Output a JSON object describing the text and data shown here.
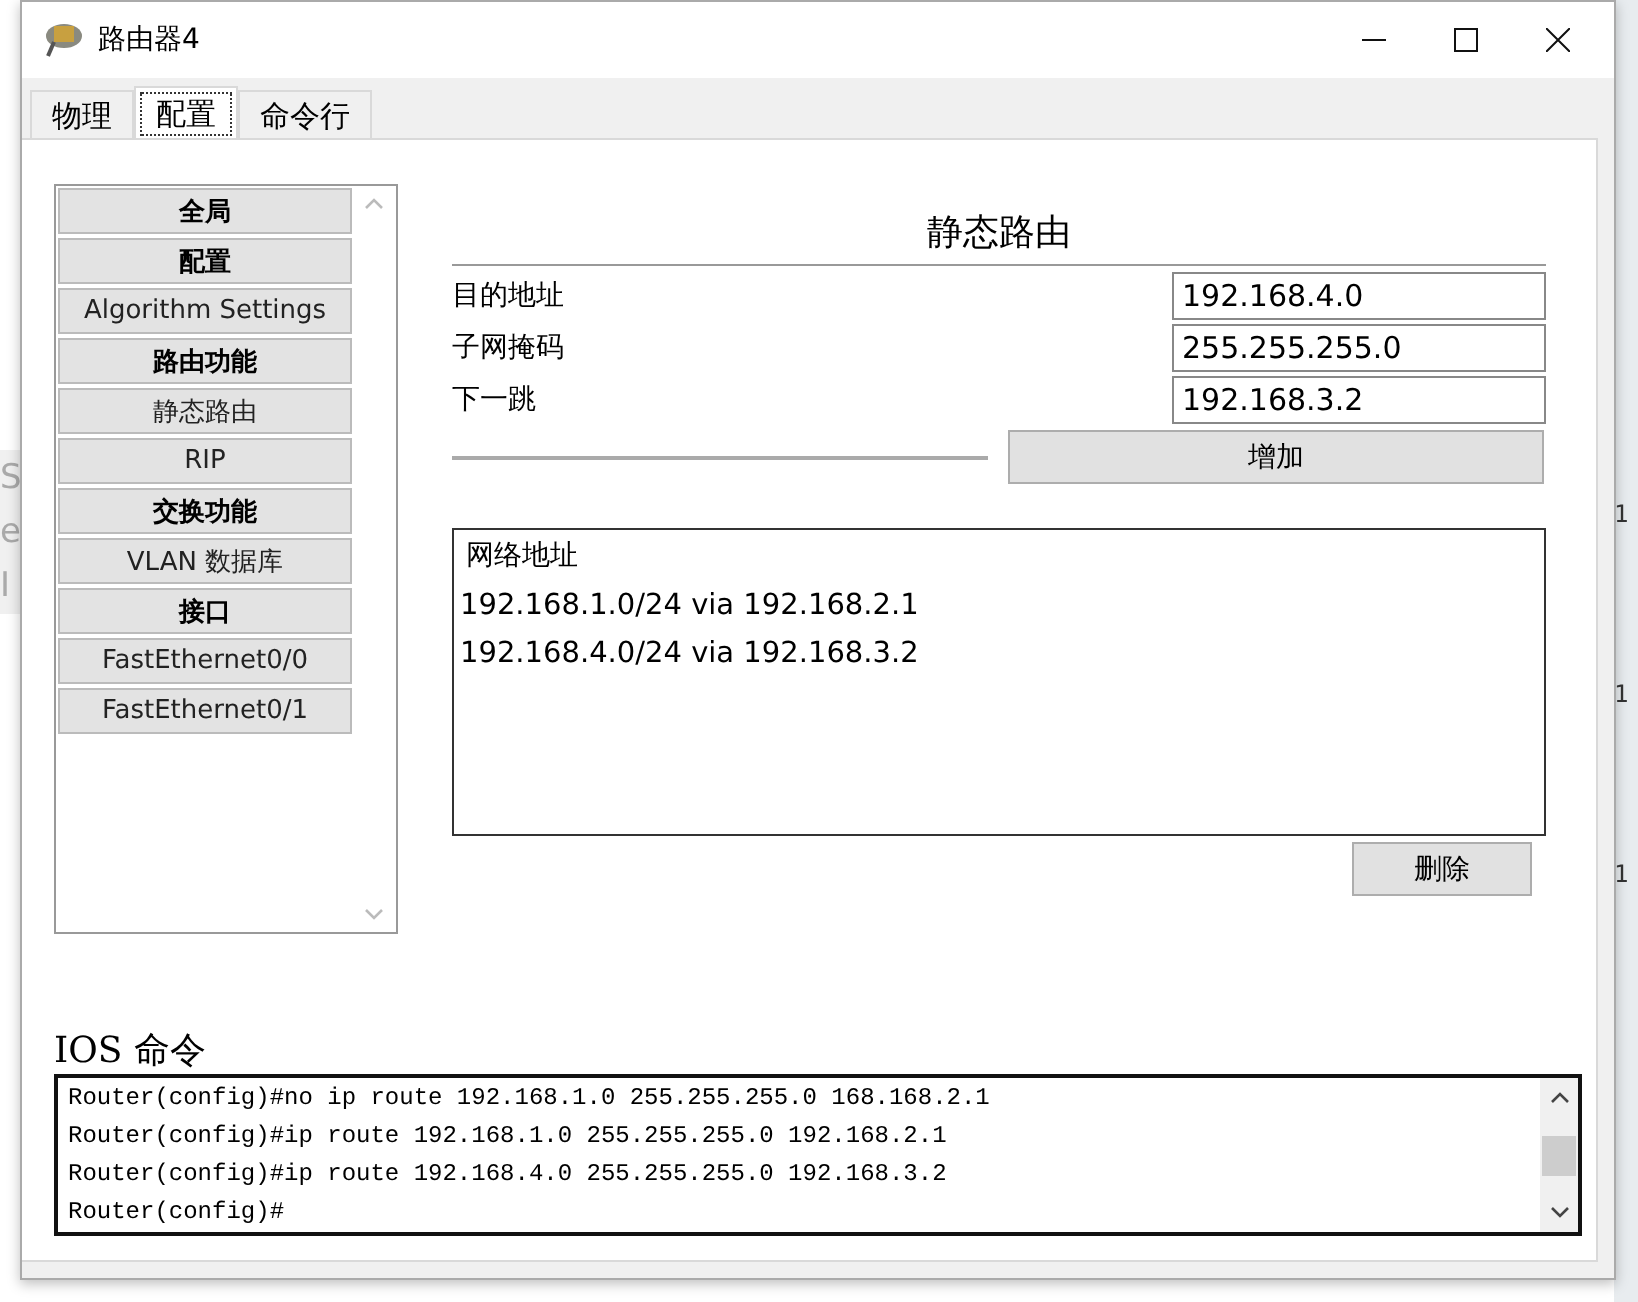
{
  "background": {
    "left_fragments": [
      "S",
      "e",
      "I"
    ],
    "right_fragments": [
      "1",
      "1",
      "1"
    ]
  },
  "window": {
    "title": "路由器4"
  },
  "tabs": [
    {
      "label": "物理",
      "selected": false
    },
    {
      "label": "配置",
      "selected": true
    },
    {
      "label": "命令行",
      "selected": false
    }
  ],
  "sidebar": {
    "items": [
      {
        "label": "全局",
        "kind": "header"
      },
      {
        "label": "配置",
        "kind": "header"
      },
      {
        "label": "Algorithm Settings",
        "kind": "item"
      },
      {
        "label": "路由功能",
        "kind": "header"
      },
      {
        "label": "静态路由",
        "kind": "item"
      },
      {
        "label": "RIP",
        "kind": "item"
      },
      {
        "label": "交换功能",
        "kind": "header"
      },
      {
        "label": "VLAN 数据库",
        "kind": "item"
      },
      {
        "label": "接口",
        "kind": "header"
      },
      {
        "label": "FastEthernet0/0",
        "kind": "item"
      },
      {
        "label": "FastEthernet0/1",
        "kind": "item"
      }
    ]
  },
  "static_route": {
    "title": "静态路由",
    "fields": [
      {
        "label": "目的地址",
        "value": "192.168.4.0"
      },
      {
        "label": "子网掩码",
        "value": "255.255.255.0"
      },
      {
        "label": "下一跳",
        "value": "192.168.3.2"
      }
    ],
    "add_button": "增加",
    "list_header": "网络地址",
    "routes": [
      "192.168.1.0/24 via 192.168.2.1",
      "192.168.4.0/24 via 192.168.3.2"
    ],
    "delete_button": "删除"
  },
  "ios": {
    "title": "IOS 命令",
    "lines": [
      "Router(config)#no ip route 192.168.1.0 255.255.255.0 168.168.2.1",
      "Router(config)#ip route 192.168.1.0 255.255.255.0 192.168.2.1",
      "Router(config)#ip route 192.168.4.0 255.255.255.0 192.168.3.2",
      "Router(config)#"
    ]
  }
}
